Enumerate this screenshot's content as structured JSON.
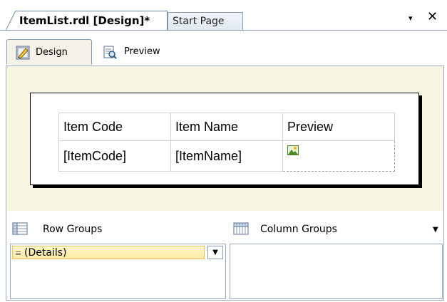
{
  "document_tabs": {
    "active": "ItemList.rdl [Design]*",
    "inactive": "Start Page"
  },
  "window_controls": {
    "dropdown": "▾",
    "close": "✕"
  },
  "view_tabs": {
    "design": "Design",
    "preview": "Preview"
  },
  "report_table": {
    "headers": [
      "Item Code",
      "Item Name",
      "Preview"
    ],
    "rows": [
      [
        "[ItemCode]",
        "[ItemName]",
        ""
      ]
    ],
    "image_cell_icon": "image-placeholder-icon"
  },
  "grouping": {
    "row_groups_label": "Row Groups",
    "column_groups_label": "Column Groups",
    "row_group_items": [
      "(Details)"
    ]
  },
  "colors": {
    "design_surface": "#f8f7e4",
    "tab_border": "#8da0b8",
    "selected_group": "#fde9a2"
  }
}
